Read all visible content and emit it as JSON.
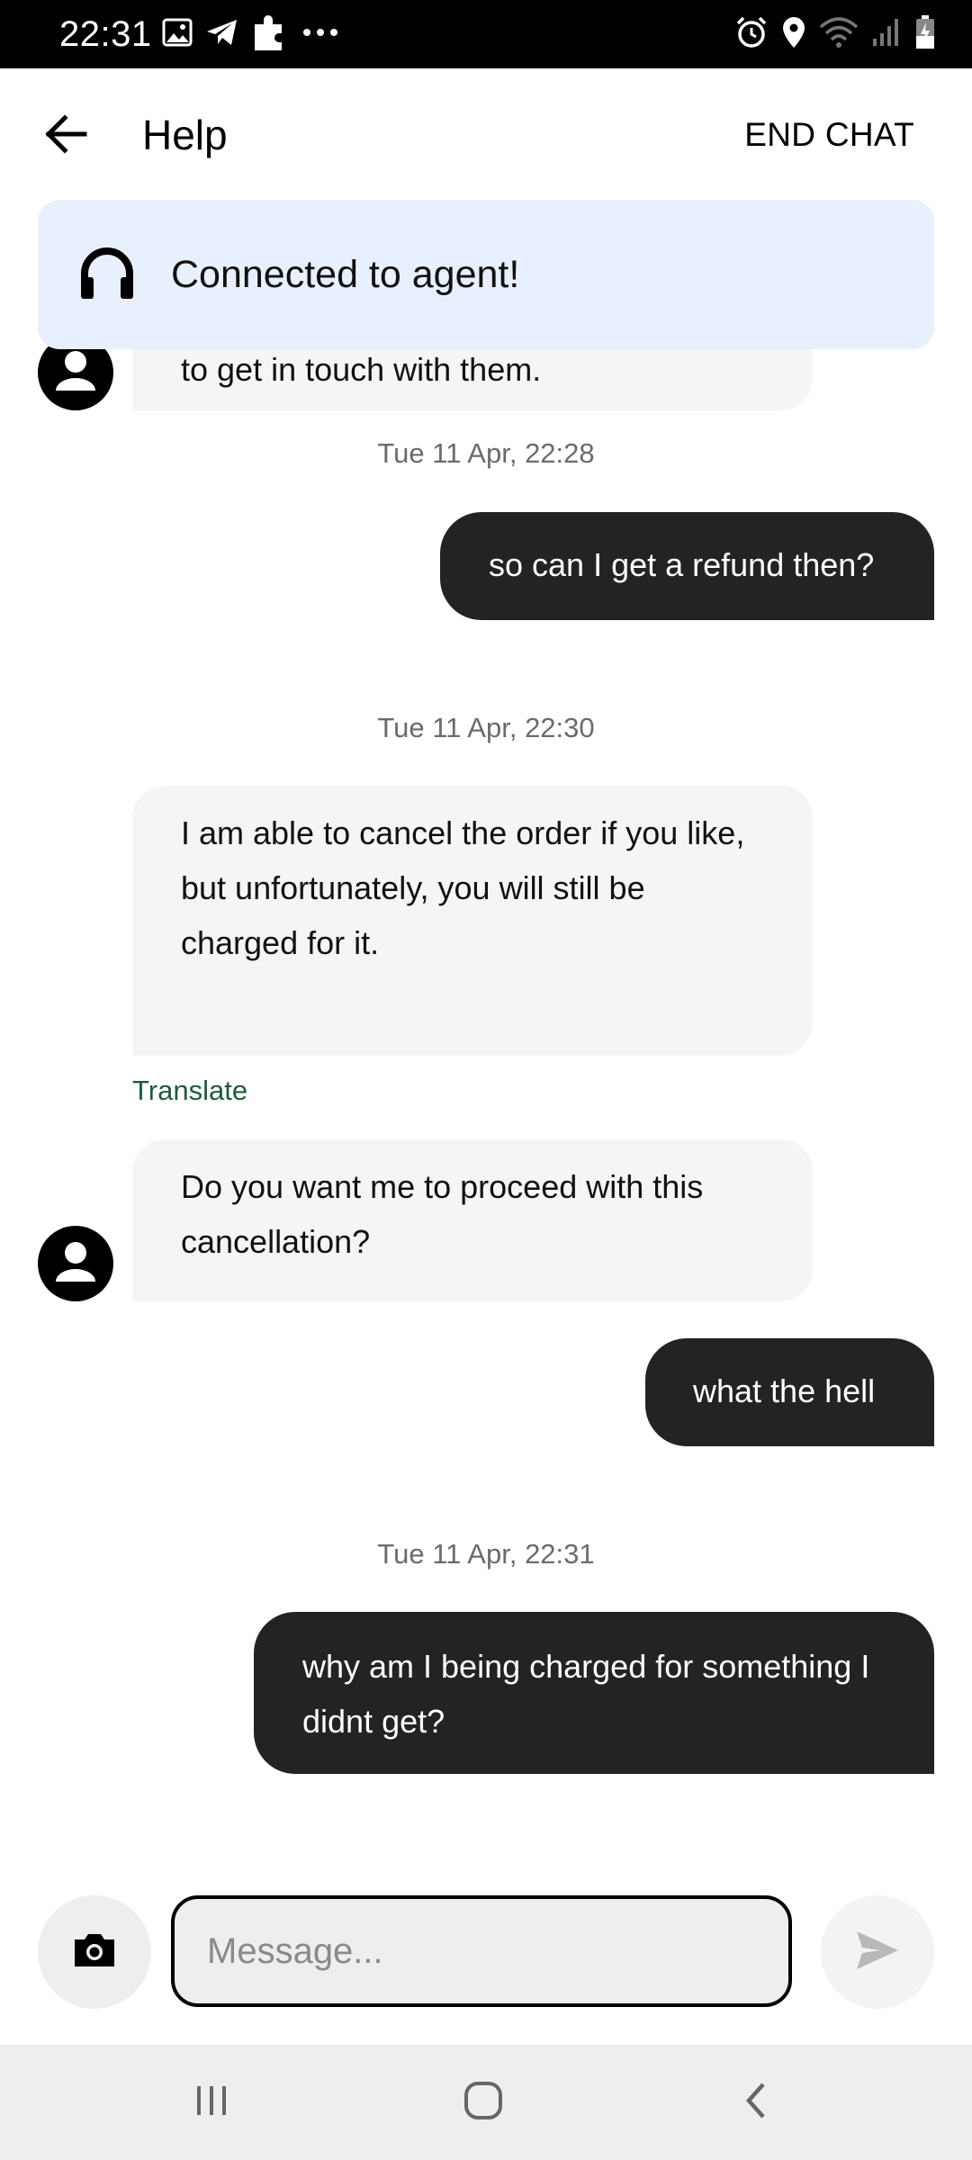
{
  "status_bar": {
    "time": "22:31",
    "left_icons": [
      "image-icon",
      "telegram-icon",
      "puzzle-icon",
      "more-dots-icon"
    ],
    "right_icons": [
      "alarm-icon",
      "location-icon",
      "wifi-icon",
      "signal-icon",
      "battery-charging-icon"
    ]
  },
  "app_bar": {
    "title": "Help",
    "end_chat_label": "END CHAT"
  },
  "banner": {
    "text": "Connected to agent!"
  },
  "messages": [
    {
      "type": "incoming",
      "text": "to get in touch with them."
    },
    {
      "type": "timestamp",
      "text": "Tue 11 Apr, 22:28"
    },
    {
      "type": "outgoing",
      "text": "so can I get a refund then?"
    },
    {
      "type": "timestamp",
      "text": "Tue 11 Apr, 22:30"
    },
    {
      "type": "incoming",
      "text": "I am able to cancel the order if you like, but unfortunately, you will still be charged for it."
    },
    {
      "type": "link",
      "text": "Translate"
    },
    {
      "type": "incoming",
      "text": "Do you want me to proceed with this cancellation?"
    },
    {
      "type": "outgoing",
      "text": "what the hell"
    },
    {
      "type": "timestamp",
      "text": "Tue 11 Apr, 22:31"
    },
    {
      "type": "outgoing",
      "text": "why am I being charged for something I didnt get?"
    }
  ],
  "input": {
    "placeholder": "Message...",
    "value": ""
  },
  "colors": {
    "status_bar_bg": "#000000",
    "banner_bg": "#e9f0fd",
    "incoming_bubble": "#f5f5f5",
    "outgoing_bubble": "#232323",
    "translate_link": "#1e5c3a",
    "timestamp_text": "#6b6b6b",
    "nav_bar_bg": "#eeeeee"
  }
}
